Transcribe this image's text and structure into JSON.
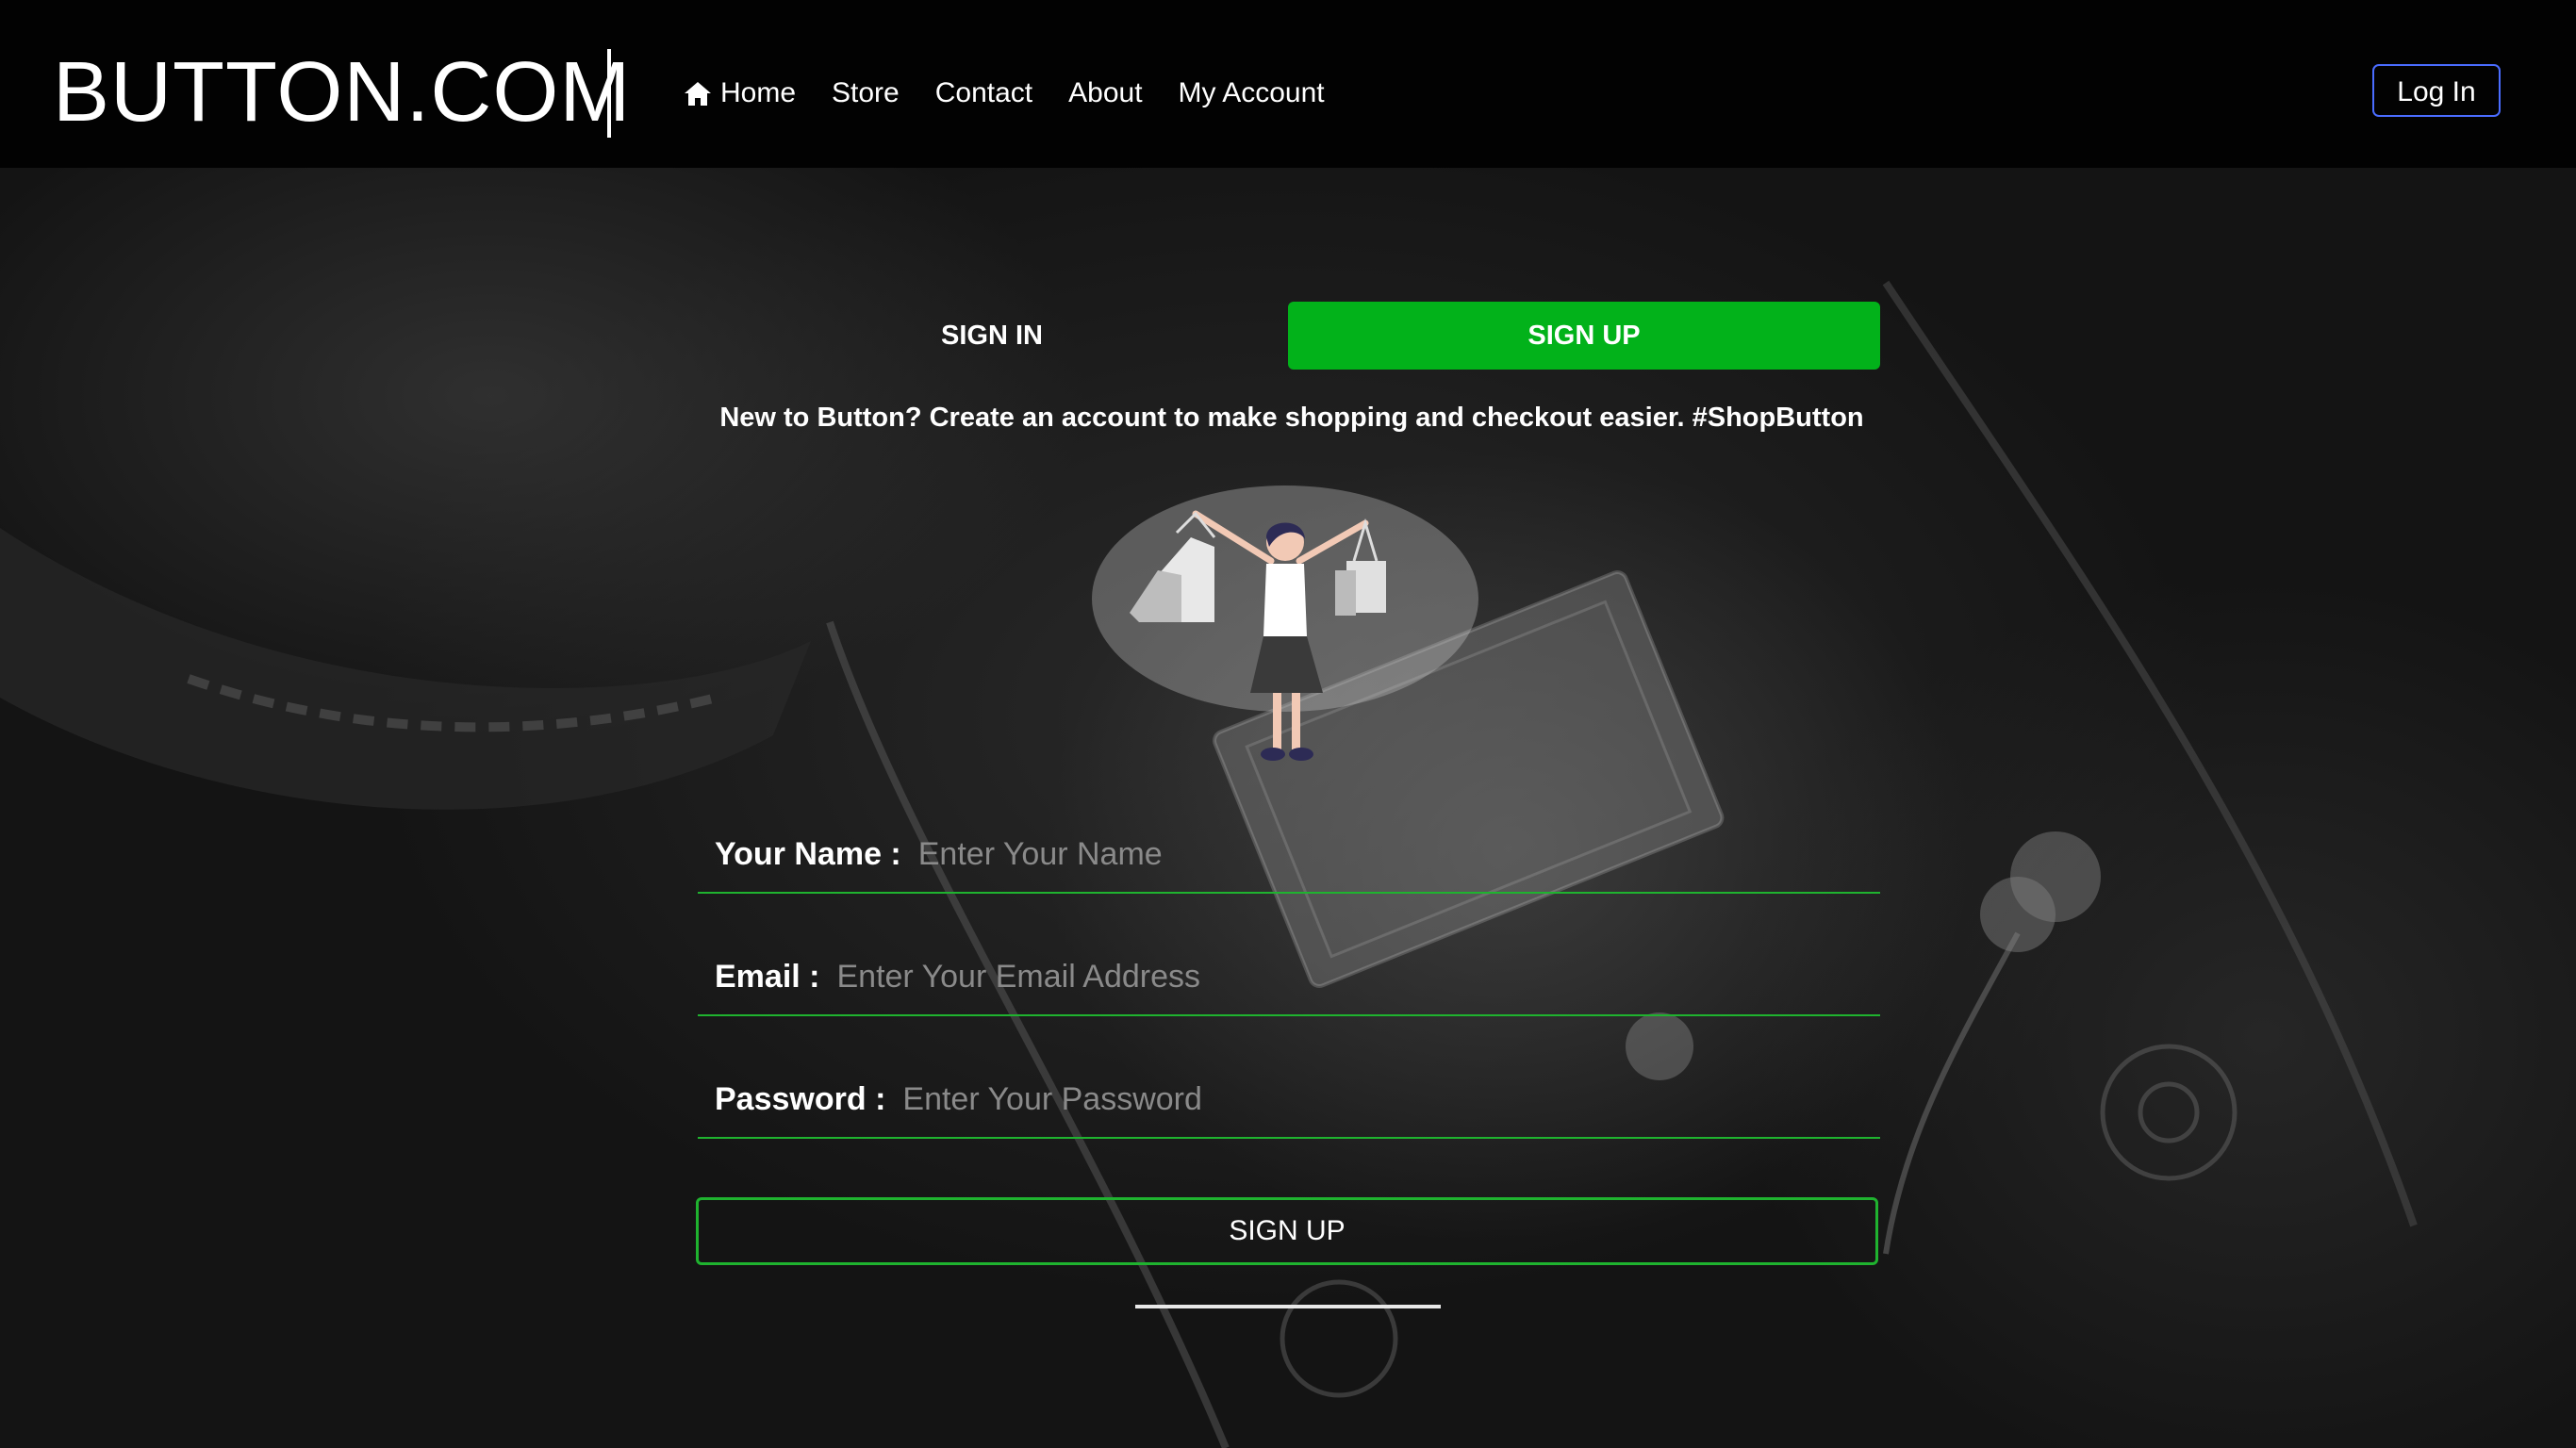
{
  "header": {
    "brand": "BUTTON.COM",
    "nav": [
      {
        "label": "Home",
        "icon": "home-icon"
      },
      {
        "label": "Store"
      },
      {
        "label": "Contact"
      },
      {
        "label": "About"
      },
      {
        "label": "My Account"
      }
    ],
    "login_label": "Log In"
  },
  "tabs": {
    "signin_label": "SIGN IN",
    "signup_label": "SIGN UP",
    "active": "signup"
  },
  "tagline": "New to Button? Create an account to make shopping and checkout easier. #ShopButton",
  "form": {
    "name_label": "Your Name :",
    "name_placeholder": "Enter Your Name",
    "name_value": "",
    "email_label": "Email :",
    "email_placeholder": "Enter Your Email Address",
    "email_value": "",
    "password_label": "Password :",
    "password_placeholder": "Enter Your Password",
    "password_value": "",
    "submit_label": "SIGN UP"
  },
  "colors": {
    "accent_green": "#02b21a",
    "field_underline": "#1fb32f",
    "login_border": "#4a6cff",
    "navbar_bg": "#020202"
  }
}
